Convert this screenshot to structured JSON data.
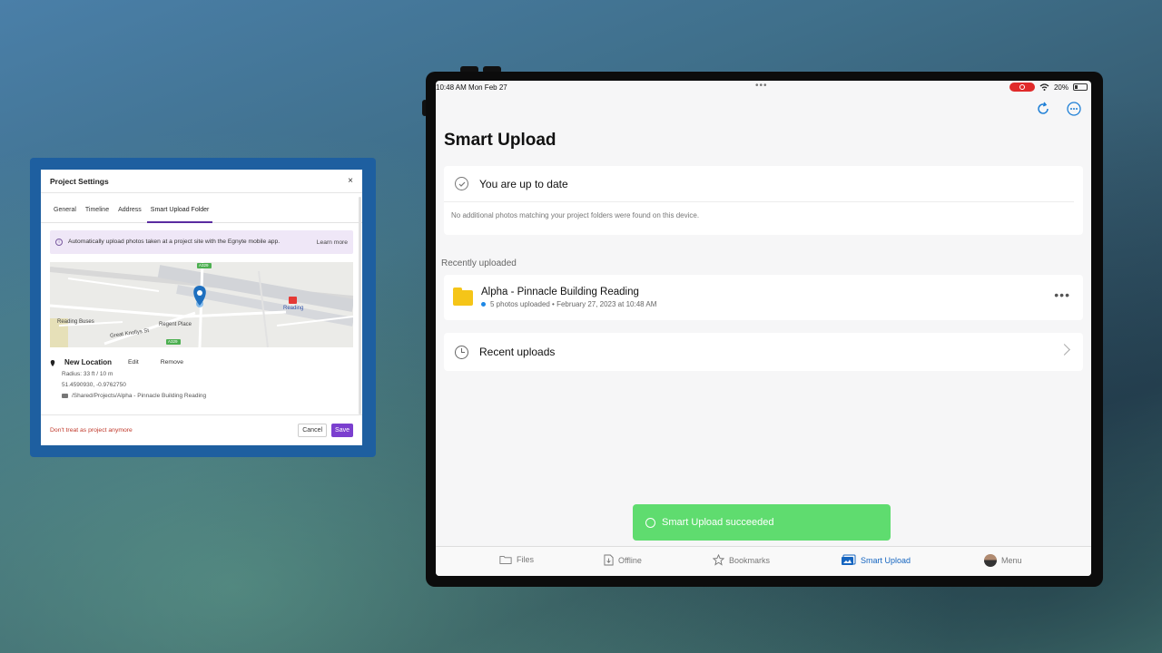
{
  "dialog": {
    "title": "Project Settings",
    "close_label": "×",
    "tabs": [
      {
        "label": "General"
      },
      {
        "label": "Timeline"
      },
      {
        "label": "Address"
      },
      {
        "label": "Smart Upload Folder"
      }
    ],
    "info": {
      "text": "Automatically upload photos taken at a project site with the Egnyte mobile app.",
      "link": "Learn more"
    },
    "map": {
      "labels": [
        "Reading Buses",
        "Regent Place",
        "Great Knollys St",
        "Reading"
      ],
      "road_badges": [
        "A329",
        "A329"
      ]
    },
    "location": {
      "name": "New Location",
      "edit_label": "Edit",
      "remove_label": "Remove",
      "radius": "Radius: 33 ft / 10 m",
      "coords": "51.4590930, -0.9762750",
      "path": "/Shared/Projects/Alpha - Pinnacle Building Reading"
    },
    "footer": {
      "danger_link": "Don't treat as project anymore",
      "cancel_label": "Cancel",
      "save_label": "Save"
    }
  },
  "tablet": {
    "status": {
      "time": "10:48 AM  Mon Feb 27",
      "dots": "•••",
      "battery": "20%"
    },
    "page_title": "Smart Upload",
    "up_to_date": {
      "text": "You are up to date",
      "subtext": "No additional photos matching your project folders were found on this device."
    },
    "recently_uploaded_label": "Recently uploaded",
    "recent_item": {
      "title": "Alpha - Pinnacle Building Reading",
      "subtitle": "5 photos uploaded • February 27, 2023 at 10:48 AM",
      "more": "•••"
    },
    "recent_uploads_label": "Recent uploads",
    "toast": "Smart Upload succeeded",
    "tabbar": [
      {
        "label": "Files"
      },
      {
        "label": "Offline"
      },
      {
        "label": "Bookmarks"
      },
      {
        "label": "Smart Upload"
      },
      {
        "label": "Menu"
      }
    ],
    "colors": {
      "accent": "#1565c0",
      "toast": "#5fdc6f",
      "save_button": "#7b3fcf",
      "folder": "#f5c518"
    }
  }
}
